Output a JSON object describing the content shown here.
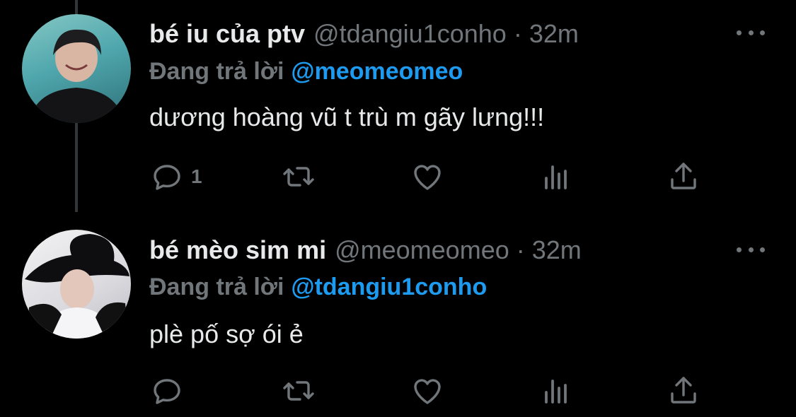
{
  "tweets": [
    {
      "display_name": "bé iu của ptv",
      "handle": "@tdangiu1conho",
      "separator": "·",
      "time": "32m",
      "replying_prefix": "Đang trả lời",
      "replying_to": "@meomeomeo",
      "text": "dương hoàng vũ t trù m gãy lưng!!!",
      "reply_count": "1"
    },
    {
      "display_name": "bé mèo sim mi",
      "handle": "@meomeomeo",
      "separator": "·",
      "time": "32m",
      "replying_prefix": "Đang trả lời",
      "replying_to": "@tdangiu1conho",
      "text": "plè pố sợ ói ẻ",
      "reply_count": ""
    }
  ],
  "colors": {
    "background": "#000000",
    "primary_text": "#e7e9ea",
    "secondary_text": "#71767b",
    "accent": "#1d9bf0",
    "thread_line": "#333639"
  },
  "icons": [
    "reply-icon",
    "retweet-icon",
    "like-icon",
    "views-icon",
    "share-icon",
    "more-icon"
  ]
}
